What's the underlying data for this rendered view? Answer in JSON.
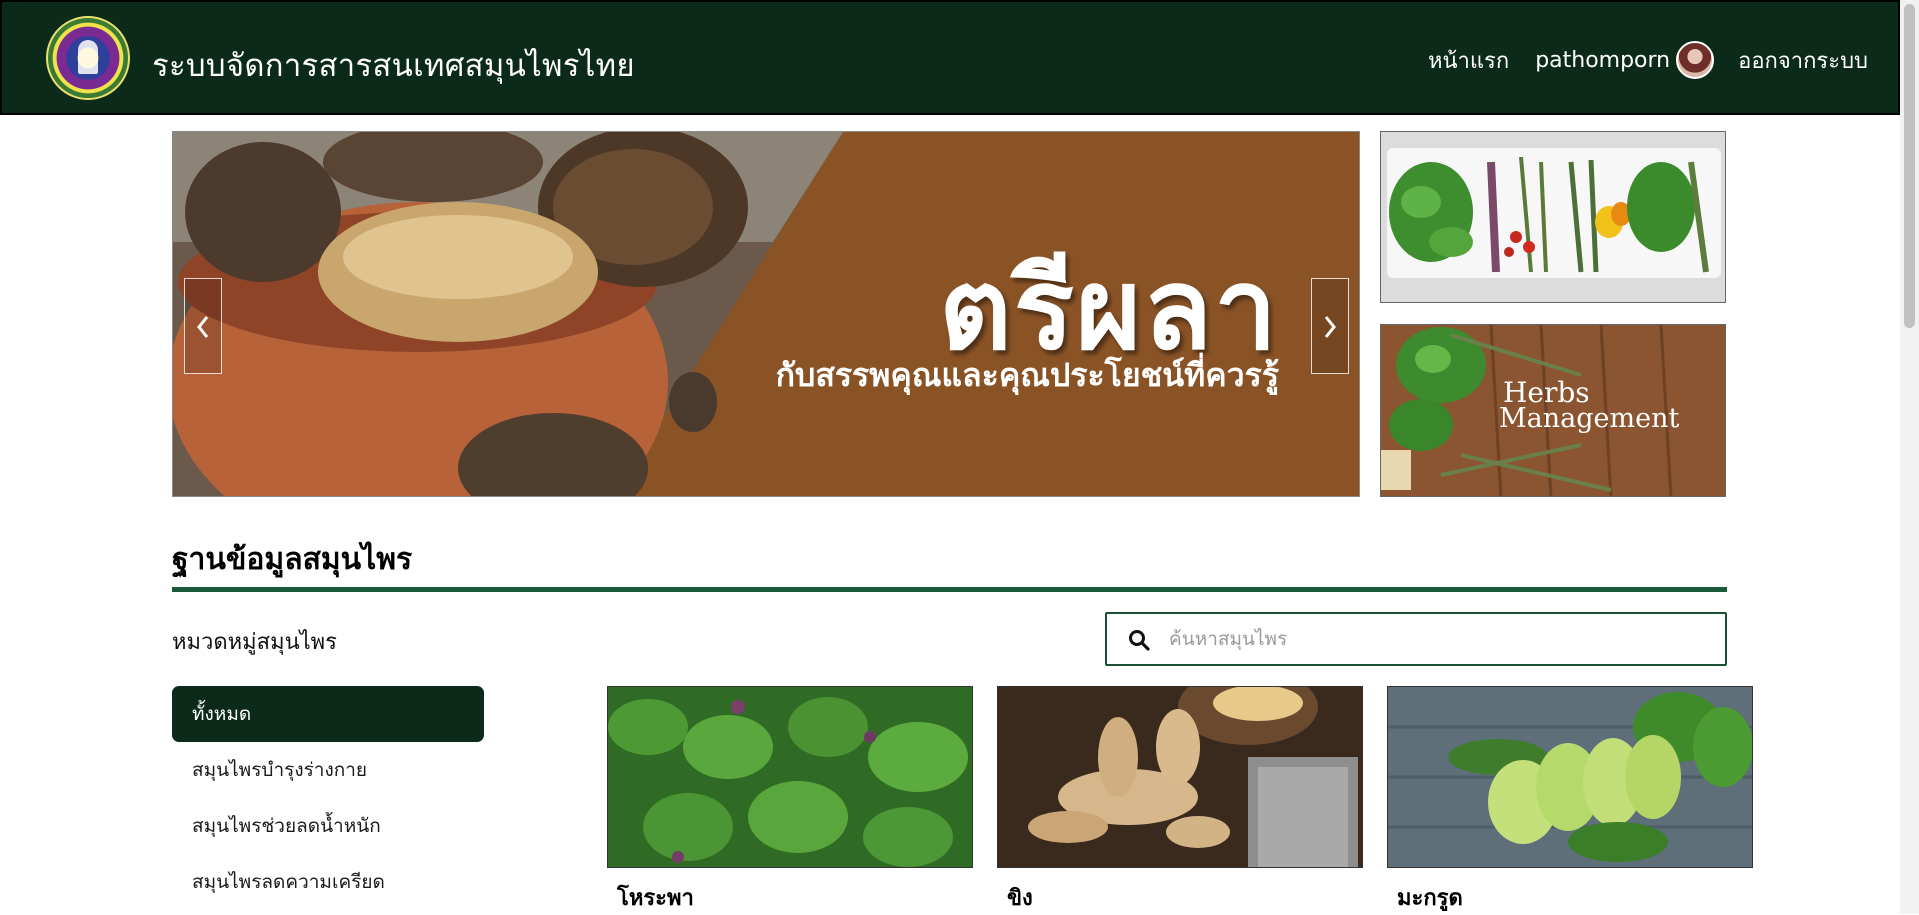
{
  "navbar": {
    "brand": "ระบบจัดการสารสนเทศสมุนไพรไทย",
    "home": "หน้าแรก",
    "username": "pathomporn",
    "logout": "ออกจากระบบ"
  },
  "carousel": {
    "title": "ตรีผลา",
    "subtitle": "กับสรรพคุณและคุณประโยชน์ที่ควรรู้",
    "prev_label": "‹",
    "next_label": "›"
  },
  "side_banners": {
    "mgmt_line1": "Herbs",
    "mgmt_line2": "Management"
  },
  "section": {
    "title": "ฐานข้อมูลสมุนไพร",
    "category_heading": "หมวดหมู่สมุนไพร"
  },
  "search": {
    "placeholder": "ค้นหาสมุนไพร"
  },
  "categories": [
    {
      "label": "ทั้งหมด",
      "active": true
    },
    {
      "label": "สมุนไพรบำรุงร่างกาย",
      "active": false
    },
    {
      "label": "สมุนไพรช่วยลดน้ำหนัก",
      "active": false
    },
    {
      "label": "สมุนไพรลดความเครียด",
      "active": false
    }
  ],
  "herbs": [
    {
      "name": "โหระพา"
    },
    {
      "name": "ขิง"
    },
    {
      "name": "มะกรูด"
    }
  ],
  "colors": {
    "navbar_bg": "#0b2a1a",
    "accent_green": "#1b5a37",
    "slide_brown": "#8a5326"
  }
}
